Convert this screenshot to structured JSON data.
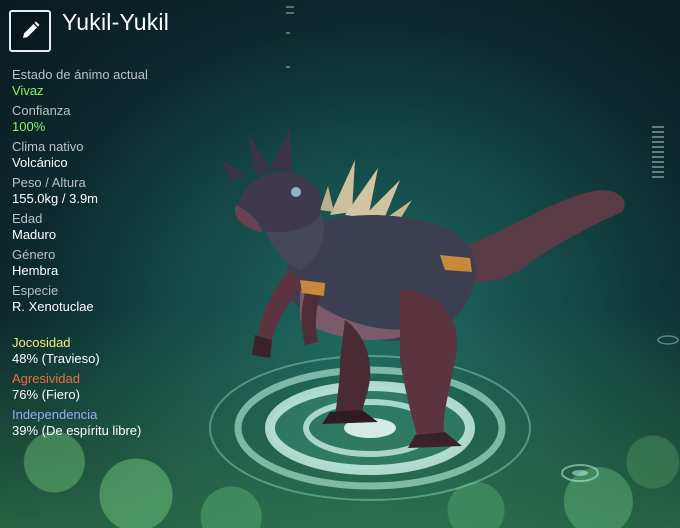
{
  "creature": {
    "name": "Yukil-Yukil"
  },
  "icons": {
    "edit": "pencil-icon"
  },
  "colors": {
    "highlight_green": "#8cf06a",
    "playfulness": "#f2ec7a",
    "aggression": "#f06a4a",
    "independence": "#9aa8ff"
  },
  "stats": {
    "mood": {
      "label": "Estado de ánimo actual",
      "value": "Vivaz"
    },
    "trust": {
      "label": "Confianza",
      "value": "100%"
    },
    "climate": {
      "label": "Clima nativo",
      "value": "Volcánico"
    },
    "size": {
      "label": "Peso / Altura",
      "value": "155.0kg / 3.9m"
    },
    "age": {
      "label": "Edad",
      "value": "Maduro"
    },
    "gender": {
      "label": "Género",
      "value": "Hembra"
    },
    "species": {
      "label": "Especie",
      "value": "R. Xenotuclae"
    }
  },
  "traits": {
    "playfulness": {
      "label": "Jocosidad",
      "value": "48% (Travieso)"
    },
    "aggression": {
      "label": "Agresividad",
      "value": "76% (Fiero)"
    },
    "independence": {
      "label": "Independencia",
      "value": "39% (De espíritu libre)"
    }
  }
}
